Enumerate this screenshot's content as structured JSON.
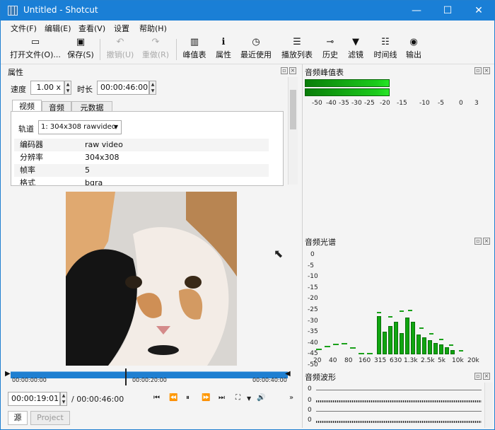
{
  "window": {
    "title": "Untitled - Shotcut",
    "minimize": "—",
    "maximize": "☐",
    "close": "✕"
  },
  "menu": [
    "文件(F)",
    "编辑(E)",
    "查看(V)",
    "设置",
    "帮助(H)"
  ],
  "toolbar": {
    "open": {
      "label": "打开文件(O)...",
      "icon": "folder-icon"
    },
    "save": {
      "label": "保存(S)",
      "icon": "floppy-icon"
    },
    "undo": {
      "label": "撤销(U)",
      "icon": "undo-icon"
    },
    "redo": {
      "label": "重做(R)",
      "icon": "redo-icon"
    },
    "peaks": {
      "label": "峰值表",
      "icon": "peak-meter-icon"
    },
    "properties": {
      "label": "属性",
      "icon": "info-icon"
    },
    "recent": {
      "label": "最近使用",
      "icon": "clock-icon"
    },
    "playlist": {
      "label": "播放列表",
      "icon": "list-icon"
    },
    "history": {
      "label": "历史",
      "icon": "history-icon"
    },
    "filters": {
      "label": "滤镜",
      "icon": "filter-icon"
    },
    "timeline": {
      "label": "时间线",
      "icon": "timeline-icon"
    },
    "export": {
      "label": "输出",
      "icon": "disc-icon"
    }
  },
  "properties": {
    "title": "属性",
    "speed_label": "速度",
    "speed_value": "1.00 x",
    "duration_label": "时长",
    "duration_value": "00:00:46:00",
    "tabs": [
      "视频",
      "音频",
      "元数据"
    ],
    "track_label": "轨道",
    "track_value": "1: 304x308 rawvideo",
    "rows": [
      {
        "key": "编码器",
        "value": "raw video"
      },
      {
        "key": "分辨率",
        "value": "304x308"
      },
      {
        "key": "帧率",
        "value": "5"
      },
      {
        "key": "格式",
        "value": "bgra"
      }
    ]
  },
  "player": {
    "timecodes": [
      "00:00:00:00",
      "00:00:20:00",
      "00:00:40:00"
    ],
    "position": "00:00:19:01",
    "duration": "/ 00:00:46:00",
    "progress": 0.413,
    "source_tab": "源",
    "project_tab": "Project"
  },
  "audio_peaks": {
    "title": "音频峰值表",
    "scale": [
      "-50",
      "-40",
      "-35",
      "-30",
      "-25",
      "-20",
      "-15",
      "-10",
      "-5",
      "0",
      "3"
    ],
    "levels_db": [
      -17,
      -17
    ]
  },
  "audio_spectrum": {
    "title": "音频光谱",
    "y_labels": [
      "0",
      "-5",
      "-10",
      "-15",
      "-20",
      "-25",
      "-30",
      "-35",
      "-40",
      "-45",
      "-50"
    ],
    "x_labels": [
      "20",
      "40",
      "80",
      "160",
      "315",
      "630",
      "1.3k",
      "2.5k",
      "5k",
      "10k",
      "20k"
    ]
  },
  "audio_waveform": {
    "title": "音频波形",
    "y_labels": [
      "0",
      "0",
      "0",
      "0"
    ]
  },
  "colors": {
    "accent": "#1a7fd6",
    "meter": "#1bcb1b",
    "timeline": "#1f7fd1",
    "playhead": "#222222"
  }
}
